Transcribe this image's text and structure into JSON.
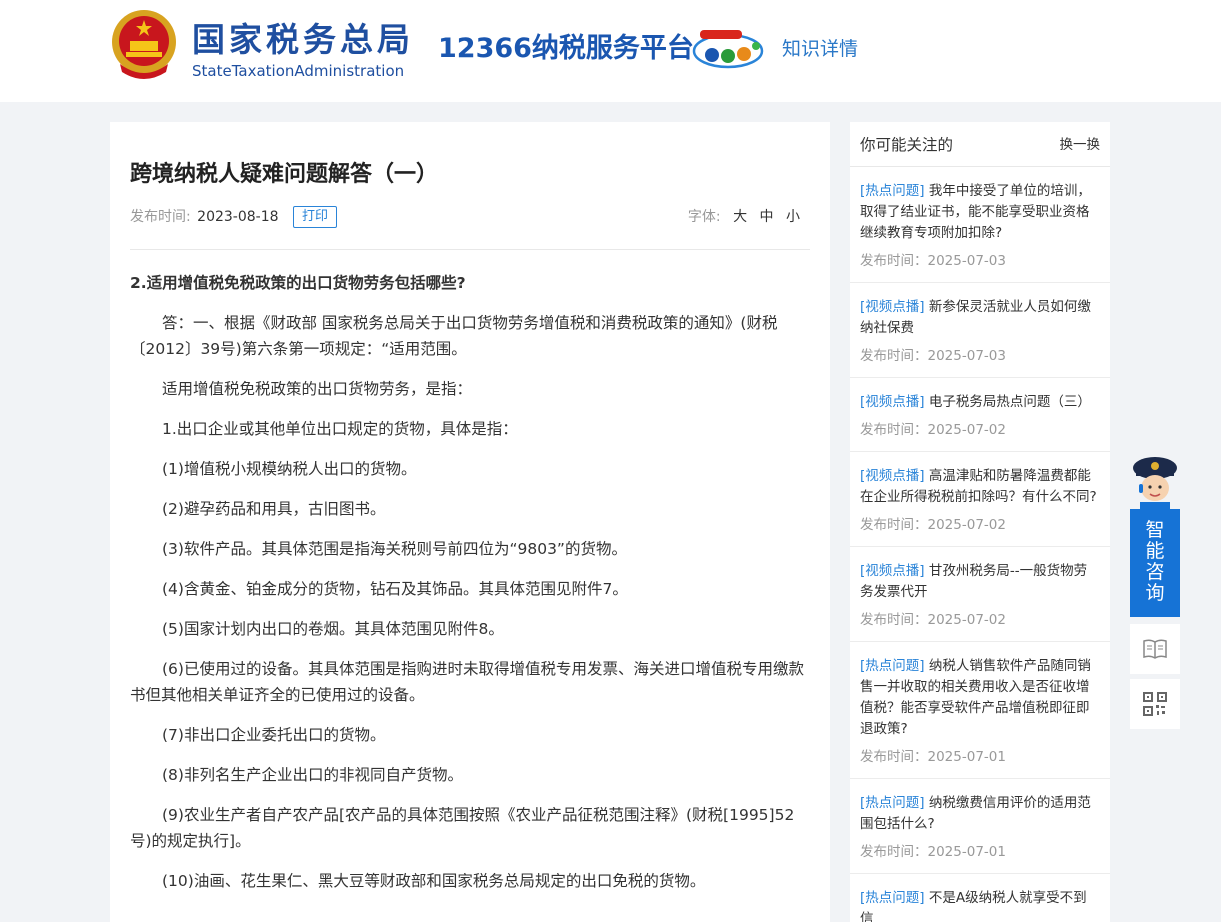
{
  "header": {
    "brand_cn": "国家税务总局",
    "brand_en": "StateTaxationAdministration",
    "platform": "12366纳税服务平台",
    "knowledge_link": "知识详情"
  },
  "article": {
    "title": "跨境纳税人疑难问题解答（一）",
    "date_label": "发布时间:",
    "date": "2023-08-18",
    "print_label": "打印",
    "font_label": "字体:",
    "font_large": "大",
    "font_medium": "中",
    "font_small": "小",
    "question": "2.适用增值税免税政策的出口货物劳务包括哪些?",
    "paragraphs": [
      "答：一、根据《财政部 国家税务总局关于出口货物劳务增值税和消费税政策的通知》(财税〔2012〕39号)第六条第一项规定：“适用范围。",
      "适用增值税免税政策的出口货物劳务，是指：",
      "1.出口企业或其他单位出口规定的货物，具体是指：",
      "(1)增值税小规模纳税人出口的货物。",
      "(2)避孕药品和用具，古旧图书。",
      "(3)软件产品。其具体范围是指海关税则号前四位为“9803”的货物。",
      "(4)含黄金、铂金成分的货物，钻石及其饰品。其具体范围见附件7。",
      "(5)国家计划内出口的卷烟。其具体范围见附件8。",
      "(6)已使用过的设备。其具体范围是指购进时未取得增值税专用发票、海关进口增值税专用缴款书但其他相关单证齐全的已使用过的设备。",
      "(7)非出口企业委托出口的货物。",
      "(8)非列名生产企业出口的非视同自产货物。",
      "(9)农业生产者自产农产品[农产品的具体范围按照《农业产品征税范围注释》(财税[1995]52号)的规定执行]。",
      "(10)油画、花生果仁、黑大豆等财政部和国家税务总局规定的出口免税的货物。"
    ]
  },
  "sidebar": {
    "title": "你可能关注的",
    "refresh_label": "换一换",
    "date_label": "发布时间：",
    "items": [
      {
        "tag": "[热点问题]",
        "text": "我年中接受了单位的培训，取得了结业证书，能不能享受职业资格继续教育专项附加扣除?",
        "date": "2025-07-03"
      },
      {
        "tag": "[视频点播]",
        "text": "新参保灵活就业人员如何缴纳社保费",
        "date": "2025-07-03"
      },
      {
        "tag": "[视频点播]",
        "text": "电子税务局热点问题（三）",
        "date": "2025-07-02"
      },
      {
        "tag": "[视频点播]",
        "text": "高温津贴和防暑降温费都能在企业所得税税前扣除吗？有什么不同?",
        "date": "2025-07-02"
      },
      {
        "tag": "[视频点播]",
        "text": "甘孜州税务局--一般货物劳务发票代开",
        "date": "2025-07-02"
      },
      {
        "tag": "[热点问题]",
        "text": "纳税人销售软件产品随同销售一并收取的相关费用收入是否征收增值税？能否享受软件产品增值税即征即退政策?",
        "date": "2025-07-01"
      },
      {
        "tag": "[热点问题]",
        "text": "纳税缴费信用评价的适用范围包括什么?",
        "date": "2025-07-01"
      },
      {
        "tag": "[热点问题]",
        "text": "不是A级纳税人就享受不到信",
        "date": ""
      }
    ]
  },
  "float": {
    "consult_label": "智能咨询",
    "consult_chars": [
      "智",
      "能",
      "咨",
      "询"
    ]
  },
  "colors": {
    "brand_blue": "#1f4fa0",
    "accent_blue": "#2a84d8",
    "consult_blue": "#1673d6",
    "page_bg": "#f1f3f6"
  },
  "icons": [
    "national-emblem-icon",
    "mascot-logo-icon",
    "assistant-avatar-icon",
    "book-icon",
    "qr-code-icon"
  ]
}
